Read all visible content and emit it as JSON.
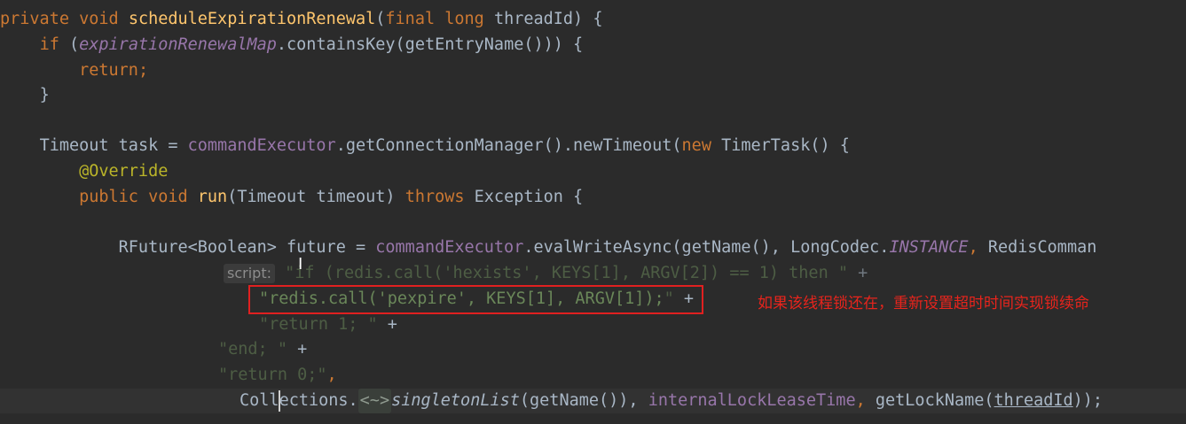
{
  "code": {
    "l1": {
      "private": "private",
      "void": "void",
      "method": "scheduleExpirationRenewal",
      "p1": "(",
      "final": "final",
      "long": "long",
      "param": " threadId) {"
    },
    "l2": {
      "if": "if",
      "open": " (",
      "map": "expirationRenewalMap",
      "rest": ".containsKey(getEntryName())) {"
    },
    "l3": {
      "ret": "return",
      "semi": ";"
    },
    "l4": {
      "brace": "}"
    },
    "l6": {
      "decl": "Timeout task = ",
      "exec": "commandExecutor",
      "mid": ".getConnectionManager().newTimeout(",
      "new": "new",
      "tail": " TimerTask() {"
    },
    "l7": {
      "annotation": "@Override"
    },
    "l8": {
      "public": "public",
      "void": "void",
      "run": "run",
      "args": "(Timeout timeout) ",
      "throws": "throws",
      "exc": " Exception {"
    },
    "l10": {
      "type": "RFuture",
      "generic": "<Boolean>",
      "decl": " future = ",
      "exec": "commandExecutor",
      "mid": ".evalWriteAsync(getName(), LongCodec.",
      "instance": "INSTANCE",
      "comma": ", ",
      "tail": "RedisComman"
    },
    "l11": {
      "hint": "script:",
      "str1": "\"if (redis.call('hexists', KEYS[1], ARGV[2]) == 1) then \"",
      "plus": " +"
    },
    "l12": {
      "str": "\"redis.call('pexpire', KEYS[1], ARGV[1]);",
      "close": "\"",
      "plus": " +"
    },
    "l13": {
      "str": "\"return 1; \"",
      "plus": " +"
    },
    "l14": {
      "str": "\"end; \"",
      "plus": " +"
    },
    "l15": {
      "str": "\"return 0;\"",
      "comma": ","
    },
    "l16": {
      "coll_a": "Coll",
      "coll_b": "ections.",
      "fold": "<~>",
      "singleton": "singletonList",
      "args": "(getName()), ",
      "lease": "internalLockLeaseTime",
      "comma": ", ",
      "getlock": "getLockName(",
      "tid": "threadId",
      "end": "));"
    }
  },
  "annotation_note": "如果该线程锁还在，重新设置超时时间实现锁续命"
}
